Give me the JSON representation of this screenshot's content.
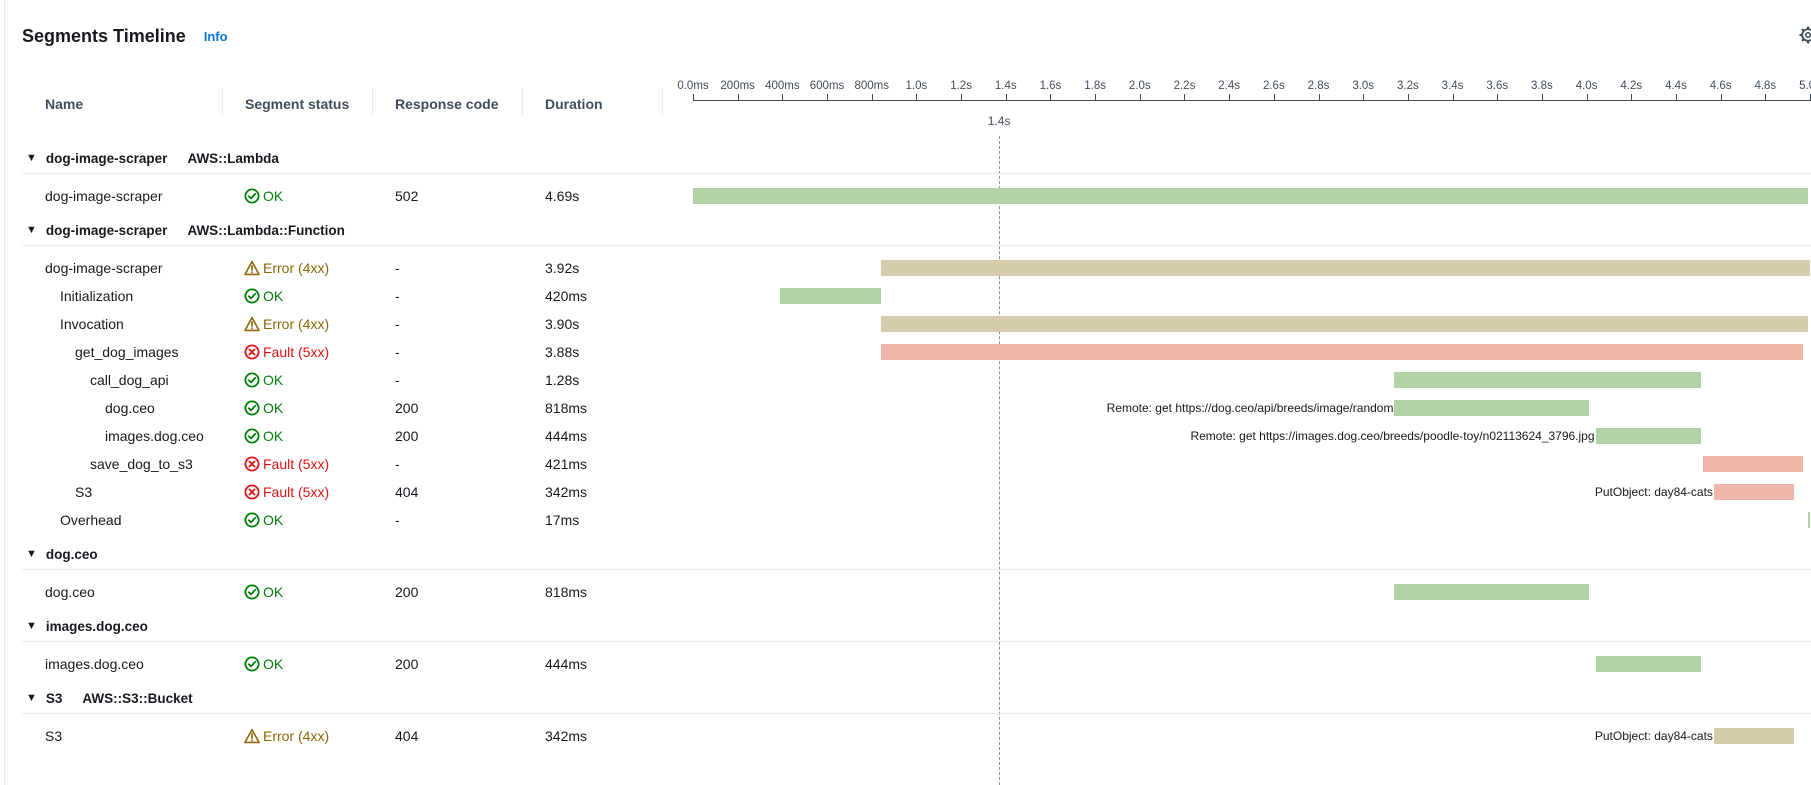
{
  "panel": {
    "title": "Segments Timeline",
    "info_label": "Info"
  },
  "columns": {
    "name": "Name",
    "status": "Segment status",
    "response": "Response code",
    "duration": "Duration"
  },
  "axis": {
    "ticks": [
      "0.0ms",
      "200ms",
      "400ms",
      "600ms",
      "800ms",
      "1.0s",
      "1.2s",
      "1.4s",
      "1.6s",
      "1.8s",
      "2.0s",
      "2.2s",
      "2.4s",
      "2.6s",
      "2.8s",
      "3.0s",
      "3.2s",
      "3.4s",
      "3.6s",
      "3.8s",
      "4.0s",
      "4.2s",
      "4.4s",
      "4.6s",
      "4.8s",
      "5.0s"
    ],
    "max_s": 5.0,
    "cursor_s": 1.37,
    "cursor_label": "1.4s"
  },
  "status_labels": {
    "ok": "OK",
    "error": "Error (4xx)",
    "fault": "Fault (5xx)"
  },
  "colors": {
    "ok": "#037f0c",
    "error": "#8d6605",
    "fault": "#d91515",
    "bar_ok": "#b2d3a6",
    "bar_error": "#d7cca9",
    "bar_fault": "#eeb5a9",
    "link": "#0972d3"
  },
  "groups": [
    {
      "name": "dog-image-scraper",
      "type": "AWS::Lambda",
      "rows": [
        {
          "name": "dog-image-scraper",
          "depth": 0,
          "status": "ok",
          "response_code": "502",
          "duration": "4.69s",
          "start_s": 0.0,
          "end_s": 4.99,
          "label": ""
        }
      ]
    },
    {
      "name": "dog-image-scraper",
      "type": "AWS::Lambda::Function",
      "rows": [
        {
          "name": "dog-image-scraper",
          "depth": 0,
          "status": "error",
          "response_code": "-",
          "duration": "3.92s",
          "start_s": 0.84,
          "end_s": 5.0,
          "label": ""
        },
        {
          "name": "Initialization",
          "depth": 1,
          "status": "ok",
          "response_code": "-",
          "duration": "420ms",
          "start_s": 0.39,
          "end_s": 0.84,
          "label": ""
        },
        {
          "name": "Invocation",
          "depth": 1,
          "status": "error",
          "response_code": "-",
          "duration": "3.90s",
          "start_s": 0.84,
          "end_s": 4.99,
          "label": ""
        },
        {
          "name": "get_dog_images",
          "depth": 2,
          "status": "fault",
          "response_code": "-",
          "duration": "3.88s",
          "start_s": 0.84,
          "end_s": 4.97,
          "label": ""
        },
        {
          "name": "call_dog_api",
          "depth": 3,
          "status": "ok",
          "response_code": "-",
          "duration": "1.28s",
          "start_s": 3.14,
          "end_s": 4.51,
          "label": ""
        },
        {
          "name": "dog.ceo",
          "depth": 4,
          "status": "ok",
          "response_code": "200",
          "duration": "818ms",
          "start_s": 3.14,
          "end_s": 4.01,
          "label": "Remote: get https://dog.ceo/api/breeds/image/random"
        },
        {
          "name": "images.dog.ceo",
          "depth": 4,
          "status": "ok",
          "response_code": "200",
          "duration": "444ms",
          "start_s": 4.04,
          "end_s": 4.51,
          "label": "Remote: get https://images.dog.ceo/breeds/poodle-toy/n02113624_3796.jpg"
        },
        {
          "name": "save_dog_to_s3",
          "depth": 3,
          "status": "fault",
          "response_code": "-",
          "duration": "421ms",
          "start_s": 4.52,
          "end_s": 4.97,
          "label": ""
        },
        {
          "name": "S3",
          "depth": 2,
          "status": "fault",
          "response_code": "404",
          "duration": "342ms",
          "start_s": 4.57,
          "end_s": 4.93,
          "label": "PutObject: day84-cats"
        },
        {
          "name": "Overhead",
          "depth": 1,
          "status": "ok",
          "response_code": "-",
          "duration": "17ms",
          "start_s": 4.99,
          "end_s": 5.0,
          "label": ""
        }
      ]
    },
    {
      "name": "dog.ceo",
      "type": "",
      "rows": [
        {
          "name": "dog.ceo",
          "depth": 0,
          "status": "ok",
          "response_code": "200",
          "duration": "818ms",
          "start_s": 3.14,
          "end_s": 4.01,
          "label": ""
        }
      ]
    },
    {
      "name": "images.dog.ceo",
      "type": "",
      "rows": [
        {
          "name": "images.dog.ceo",
          "depth": 0,
          "status": "ok",
          "response_code": "200",
          "duration": "444ms",
          "start_s": 4.04,
          "end_s": 4.51,
          "label": ""
        }
      ]
    },
    {
      "name": "S3",
      "type": "AWS::S3::Bucket",
      "rows": [
        {
          "name": "S3",
          "depth": 0,
          "status": "error",
          "response_code": "404",
          "duration": "342ms",
          "start_s": 4.57,
          "end_s": 4.93,
          "label": "PutObject: day84-cats"
        }
      ]
    }
  ]
}
